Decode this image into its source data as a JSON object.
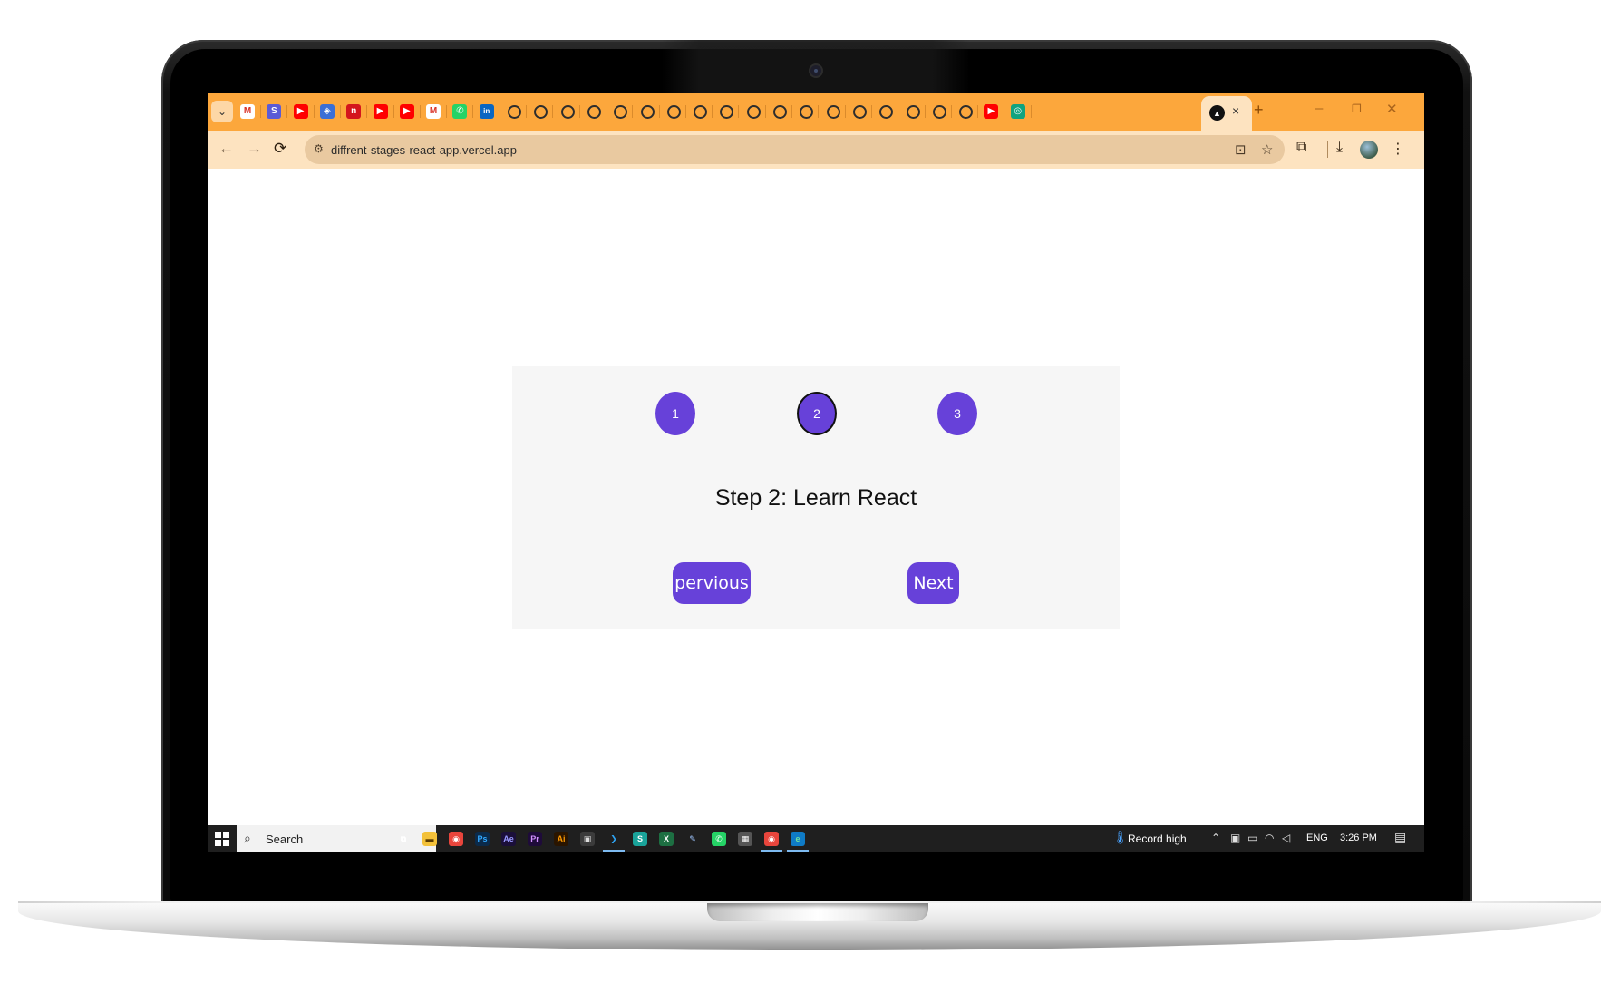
{
  "browser": {
    "url": "diffrent-stages-react-app.vercel.app",
    "active_tab_close": "×",
    "new_tab": "+",
    "tab_search": "⌄",
    "window_controls": {
      "minimize": "–",
      "restore": "❐",
      "close": "✕"
    }
  },
  "favicons": [
    "gmail",
    "stackby",
    "youtube",
    "drive",
    "app-n",
    "youtube",
    "youtube",
    "gmail",
    "whatsapp",
    "linkedin",
    "github",
    "github",
    "github",
    "github",
    "github",
    "github",
    "github",
    "github",
    "github",
    "github",
    "github",
    "github",
    "github",
    "github",
    "github",
    "github",
    "github",
    "github",
    "youtube",
    "chatgpt"
  ],
  "toolbar": {
    "back": "←",
    "forward": "→",
    "reload": "⟳",
    "install": "⊡",
    "bookmark": "☆",
    "extensions": "⧉",
    "download": "⤓",
    "menu": "⋮",
    "site_info": "⚙"
  },
  "steps": {
    "labels": [
      "1",
      "2",
      "3"
    ],
    "active_index": 1,
    "message": "Step 2: Learn React",
    "previous_label": "pervious",
    "next_label": "Next"
  },
  "colors": {
    "accent": "#6741d9",
    "tabstrip": "#fca73c",
    "toolbar": "#fde3c0",
    "card": "#f6f6f6"
  },
  "taskbar": {
    "search_placeholder": "Search",
    "weather": "Record high",
    "language": "ENG",
    "time": "3:26 PM"
  }
}
